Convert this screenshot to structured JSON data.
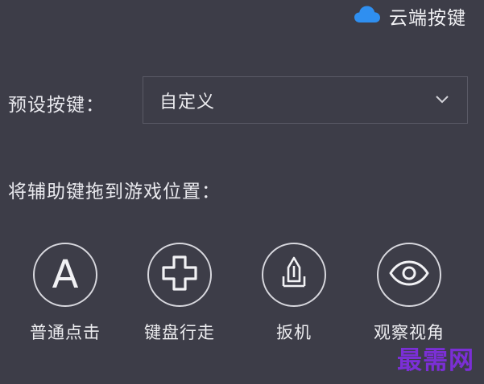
{
  "header": {
    "cloud_keys_label": "云端按键",
    "cloud_icon": "cloud-icon"
  },
  "preset": {
    "label": "预设按键：",
    "selected_value": "自定义",
    "dropdown_icon": "chevron-down-icon"
  },
  "instruction": "将辅助键拖到游戏位置：",
  "tools": [
    {
      "label": "普通点击",
      "icon": "letter-a-icon"
    },
    {
      "label": "键盘行走",
      "icon": "dpad-cross-icon"
    },
    {
      "label": "扳机",
      "icon": "trigger-icon"
    },
    {
      "label": "观察视角",
      "icon": "eye-icon"
    }
  ],
  "watermark": "最需网",
  "colors": {
    "background": "#3d3d48",
    "cloud": "#2f8ff0",
    "text": "#ececef",
    "watermark": "#7b2fd6"
  }
}
